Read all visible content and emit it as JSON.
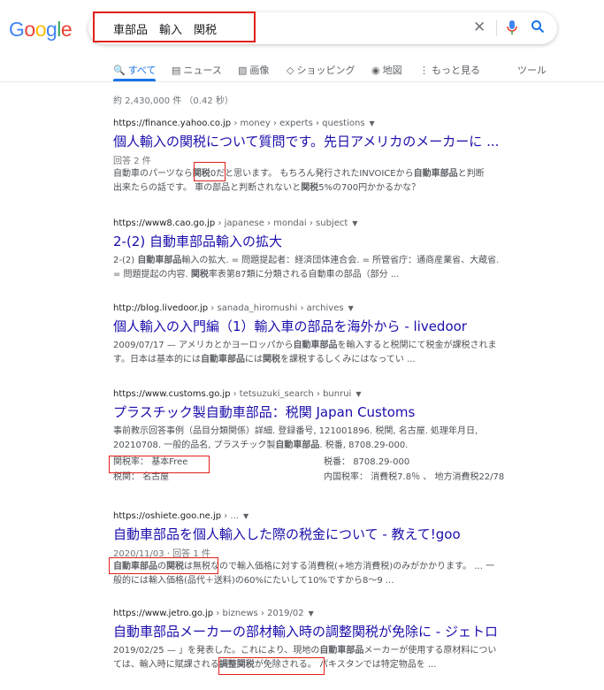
{
  "logo": {
    "letters": [
      "G",
      "o",
      "o",
      "g",
      "l",
      "e"
    ],
    "colors": [
      "#4285F4",
      "#EA4335",
      "#FBBC05",
      "#4285F4",
      "#34A853",
      "#EA4335"
    ]
  },
  "search": {
    "query": "車部品　輸入　関税"
  },
  "tabs": [
    {
      "label": "すべて",
      "icon": "search-icon"
    },
    {
      "label": "ニュース",
      "icon": "news-icon"
    },
    {
      "label": "画像",
      "icon": "image-icon"
    },
    {
      "label": "ショッピング",
      "icon": "tag-icon"
    },
    {
      "label": "地図",
      "icon": "pin-icon"
    },
    {
      "label": "もっと見る",
      "icon": "more-icon"
    },
    {
      "label": "ツール",
      "icon": ""
    }
  ],
  "stats": "約 2,430,000 件 （0.42 秒）",
  "results": [
    {
      "domain": "https://finance.yahoo.co.jp",
      "crumbs": " › money › experts › questions",
      "title": "個人輸入の関税について質問です。先日アメリカのメーカーに ...",
      "meta": "回答 2 件",
      "snippet1_a": "自動車のパーツなら",
      "snippet1_b": "関税",
      "snippet1_c": "0だと思います。 もちろん発行されたINVOICEから",
      "snippet1_d": "自動車部品",
      "snippet1_e": "と判断",
      "snippet2_a": "出来たらの話です。 車の部品と判断されないと",
      "snippet2_b": "関税",
      "snippet2_c": "5%の700円かかるかな？"
    },
    {
      "domain": "https://www8.cao.go.jp",
      "crumbs": " › japanese › mondai › subject",
      "title": "2-(2) 自動車部品輸入の拡大",
      "snippet1_a": "2-(2) ",
      "snippet1_b": "自動車部品",
      "snippet1_c": "輸入の拡大. = 問題提起者：経済団体連合会. = 所管省庁：通商産業省、大蔵省.",
      "snippet2_a": "= 問題提起の内容. ",
      "snippet2_b": "関税",
      "snippet2_c": "率表第87類に分類される自動車の部品（部分 ..."
    },
    {
      "domain": "http://blog.livedoor.jp",
      "crumbs": " › sanada_hiromushi › archives",
      "title": "個人輸入の入門編（1）輸入車の部品を海外から - livedoor",
      "snippet1_a": "2009/07/17 — アメリカとかヨーロッパから",
      "snippet1_b": "自動車部品",
      "snippet1_c": "を輸入すると税関にて税金が課税されま",
      "snippet2_a": "す。日本は基本的には",
      "snippet2_b": "自動車部品",
      "snippet2_c": "には",
      "snippet2_d": "関税",
      "snippet2_e": "を課税するしくみにはなってい ..."
    },
    {
      "domain": "https://www.customs.go.jp",
      "crumbs": " › tetsuzuki_search › bunrui",
      "title": "プラスチック製自動車部品：税関 Japan Customs",
      "snippet1": "事前教示回答事例（品目分類関係）詳細. 登録番号, 121001896. 税関, 名古屋. 処理年月日,",
      "snippet2_a": "20210708. 一般的品名, プラスチック製",
      "snippet2_b": "自動車部品",
      "snippet2_c": ". 税番, 8708.29-000.",
      "f1_label": "関税率：",
      "f1_value": "基本Free",
      "f2_label": "税番：",
      "f2_value": "8708.29-000",
      "f3_label": "税関：",
      "f3_value": "名古屋",
      "f4_label": "内国税率：",
      "f4_value": "消費税7.8％ 、 地方消費税22/78"
    },
    {
      "domain": "https://oshiete.goo.ne.jp",
      "crumbs": " › ...",
      "title": "自動車部品を個人輸入した際の税金について - 教えて!goo",
      "meta": "2020/11/03 · 回答 1 件",
      "snippet1_a": "自動車部品",
      "snippet1_b": "の",
      "snippet1_c": "関税",
      "snippet1_d": "は無税なので輸入価格に対する消費税(+地方消費税)のみがかかります。 ... 一",
      "snippet2": "般的には輸入価格(品代＋送料)の60%にたいして10%ですから8～9 ..."
    },
    {
      "domain": "https://www.jetro.go.jp",
      "crumbs": " › biznews › 2019/02",
      "title": "自動車部品メーカーの部材輸入時の調整関税が免除に - ジェトロ",
      "snippet1_a": "2019/02/25 — 」を発表した。これにより、現地の",
      "snippet1_b": "自動車部品",
      "snippet1_c": "メーカーが使用する原材料につい",
      "snippet2_a": "ては、輸入時に賦課される",
      "snippet2_b": "調整関税",
      "snippet2_c": "が免除される。 パキスタンでは特定物品を ..."
    }
  ]
}
